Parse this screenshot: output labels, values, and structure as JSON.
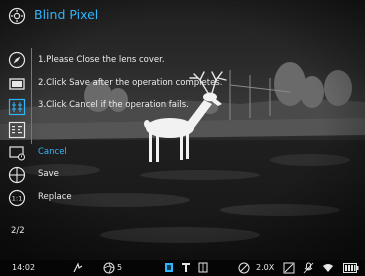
{
  "header": {
    "title": "Blind Pixel",
    "icon": "settings-gear-icon"
  },
  "instructions": [
    "1.Please Close the lens cover.",
    "2.Click Save after the operation completes.",
    "3.Click Cancel if the operation fails."
  ],
  "menu": {
    "cancel_label": "Cancel",
    "save_label": "Save",
    "replace_label": "Replace",
    "replace_icon_text": "1:1",
    "active_color": "#34b7ff"
  },
  "sidebar_icons": [
    "compass-icon",
    "rectangle-icon",
    "grid-mode-icon",
    "pixel-mode-icon"
  ],
  "page_indicator": "2/2",
  "status_bar": {
    "time": "14:02",
    "aperture_value": "5",
    "zoom": "2.0X",
    "battery_level": 1.0
  }
}
